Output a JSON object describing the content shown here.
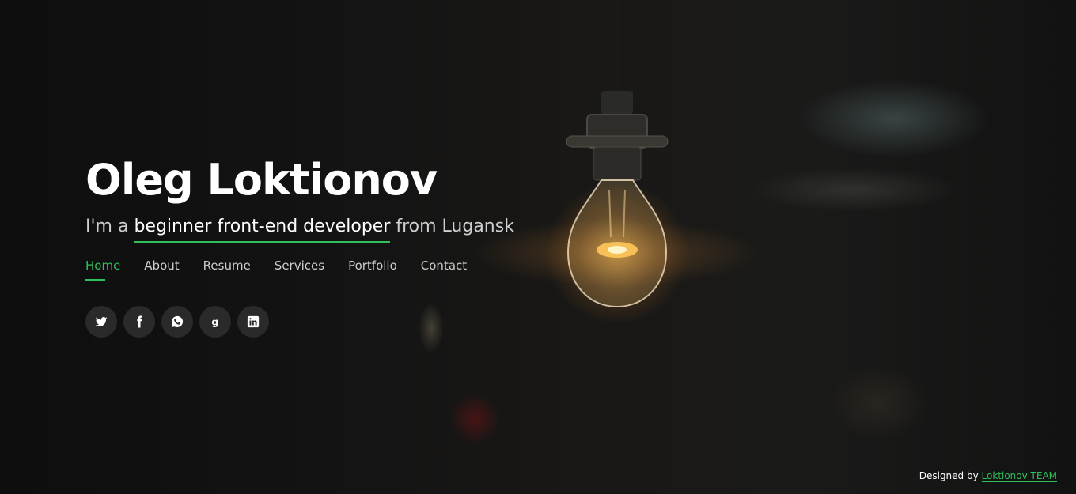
{
  "hero": {
    "name": "Oleg Loktionov",
    "tagline_prefix": "I'm a ",
    "tagline_typed": "beginner front-end developer",
    "tagline_suffix": " from Lugansk"
  },
  "nav": {
    "items": [
      "Home",
      "About",
      "Resume",
      "Services",
      "Portfolio",
      "Contact"
    ],
    "active": "Home"
  },
  "social": {
    "icons": [
      "twitter-icon",
      "facebook-icon",
      "whatsapp-icon",
      "google-icon",
      "linkedin-icon"
    ]
  },
  "footer": {
    "prefix": "Designed by ",
    "link": "Loktionov TEAM"
  },
  "colors": {
    "accent": "#2fbf5b",
    "background": "#0e0e0e",
    "text": "#ffffff"
  }
}
